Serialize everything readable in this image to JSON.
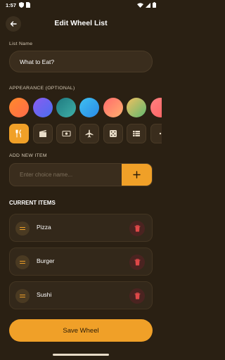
{
  "status_bar": {
    "time": "1:57"
  },
  "header": {
    "title": "Edit Wheel List"
  },
  "list_name": {
    "label": "List Name",
    "value": "What to Eat?"
  },
  "appearance": {
    "label": "APPEARANCE (OPTIONAL)",
    "colors": [
      {
        "from": "#ff8a2b",
        "to": "#ff6a4a"
      },
      {
        "from": "#8a5cf0",
        "to": "#4a6ef0"
      },
      {
        "from": "#1f7a80",
        "to": "#3fb0a8"
      },
      {
        "from": "#3fc0f0",
        "to": "#2a8ae8"
      },
      {
        "from": "#ff6a6a",
        "to": "#ffb070"
      },
      {
        "from": "#f0c060",
        "to": "#60b870"
      },
      {
        "from": "#ff8080",
        "to": "#ff6060"
      }
    ],
    "icons": [
      "fork-knife-icon",
      "movie-clapper-icon",
      "money-icon",
      "airplane-icon",
      "dice-icon",
      "list-icon",
      "more-icon"
    ],
    "selected_icon": "fork-knife-icon"
  },
  "add_item": {
    "label": "ADD NEW ITEM",
    "placeholder": "Enter choice name..."
  },
  "current_items": {
    "title": "CURRENT ITEMS",
    "items": [
      {
        "name": "Pizza"
      },
      {
        "name": "Burger"
      },
      {
        "name": "Sushi"
      }
    ]
  },
  "save_button": {
    "label": "Save Wheel"
  },
  "colors": {
    "accent": "#f0a028",
    "background": "#2a2013",
    "delete": "#e04848"
  }
}
